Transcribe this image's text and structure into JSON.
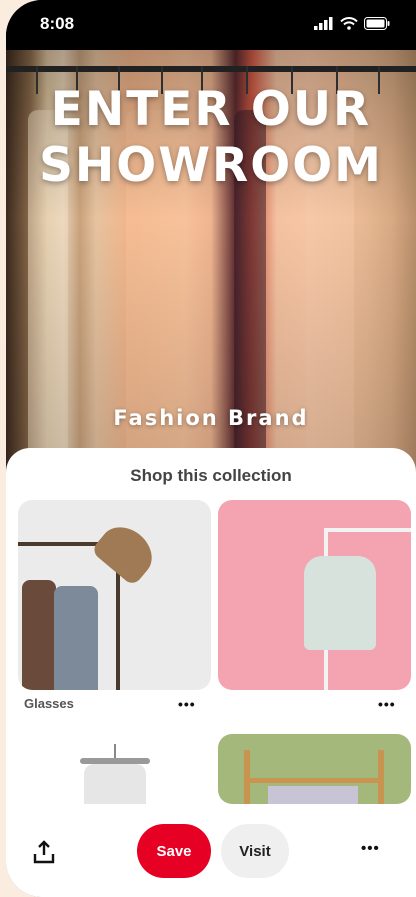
{
  "status_bar": {
    "time": "8:08"
  },
  "hero": {
    "title": "ENTER OUR SHOWROOM",
    "subtitle": "Fashion Brand"
  },
  "collection": {
    "title": "Shop this collection",
    "items": [
      {
        "label": "Glasses",
        "more": "•••"
      },
      {
        "label": "",
        "more": "•••"
      },
      {
        "label": ""
      },
      {
        "label": ""
      }
    ]
  },
  "actions": {
    "save_label": "Save",
    "visit_label": "Visit",
    "more": "•••"
  },
  "colors": {
    "save": "#e60023",
    "visit_bg": "#efefef",
    "page_bg": "#fbece0",
    "pink_card": "#f4a3b1",
    "green_card": "#a4b87c"
  }
}
